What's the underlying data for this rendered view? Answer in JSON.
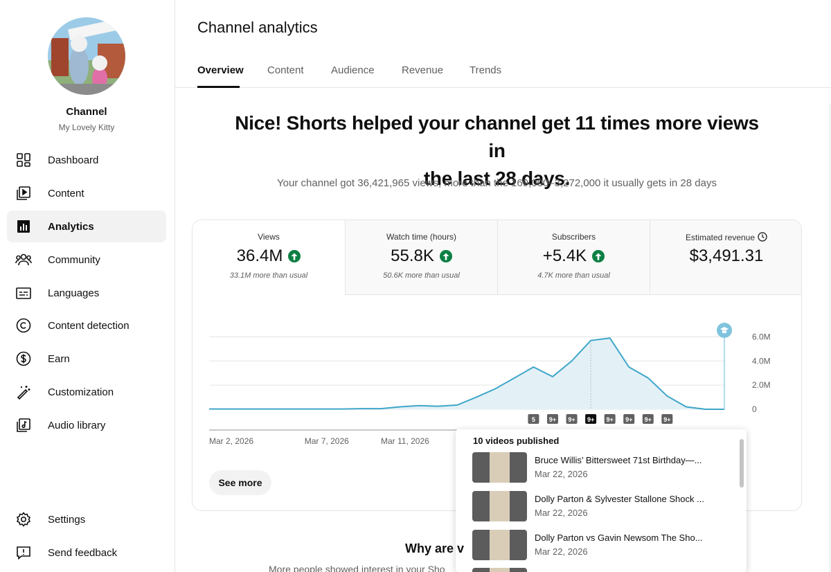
{
  "channel": {
    "title": "Channel",
    "name": "My Lovely Kitty"
  },
  "sidebar": {
    "items": [
      {
        "label": "Dashboard",
        "icon": "dashboard-icon"
      },
      {
        "label": "Content",
        "icon": "content-icon"
      },
      {
        "label": "Analytics",
        "icon": "analytics-icon",
        "active": true
      },
      {
        "label": "Community",
        "icon": "community-icon"
      },
      {
        "label": "Languages",
        "icon": "languages-icon"
      },
      {
        "label": "Content detection",
        "icon": "copyright-icon"
      },
      {
        "label": "Earn",
        "icon": "dollar-icon"
      },
      {
        "label": "Customization",
        "icon": "magic-wand-icon"
      },
      {
        "label": "Audio library",
        "icon": "audio-library-icon"
      }
    ],
    "bottom": [
      {
        "label": "Settings",
        "icon": "gear-icon"
      },
      {
        "label": "Send feedback",
        "icon": "feedback-icon"
      }
    ]
  },
  "header": {
    "title": "Channel analytics",
    "tabs": [
      "Overview",
      "Content",
      "Audience",
      "Revenue",
      "Trends"
    ],
    "active_tab": "Overview"
  },
  "headline": {
    "line1": "Nice! Shorts helped your channel get 11 times more views in",
    "line2": "the last 28 days.",
    "subtitle": "Your channel got 36,421,965 views, more than the 169,000–3,272,000 it usually gets in 28 days"
  },
  "metrics": [
    {
      "label": "Views",
      "value": "36.4M",
      "sub": "33.1M more than usual",
      "trend": "up"
    },
    {
      "label": "Watch time (hours)",
      "value": "55.8K",
      "sub": "50.6K more than usual",
      "trend": "up"
    },
    {
      "label": "Subscribers",
      "value": "+5.4K",
      "sub": "4.7K more than usual",
      "trend": "up"
    },
    {
      "label": "Estimated revenue",
      "value": "$3,491.31",
      "sub": "",
      "trend": "none"
    }
  ],
  "colors": {
    "line": "#3ea6c9",
    "fill": "#e3f1f7",
    "green": "#0b8043",
    "marker": "#7fc4de"
  },
  "chart_data": {
    "type": "area",
    "x": [
      "Mar 2",
      "Mar 3",
      "Mar 4",
      "Mar 5",
      "Mar 6",
      "Mar 7",
      "Mar 8",
      "Mar 9",
      "Mar 10",
      "Mar 11",
      "Mar 12",
      "Mar 13",
      "Mar 14",
      "Mar 15",
      "Mar 16",
      "Mar 17",
      "Mar 18",
      "Mar 19",
      "Mar 20",
      "Mar 21",
      "Mar 22",
      "Mar 23",
      "Mar 24",
      "Mar 25",
      "Mar 26",
      "Mar 27",
      "Mar 28",
      "Mar 29"
    ],
    "series": [
      {
        "values": [
          0.02,
          0.02,
          0.02,
          0.02,
          0.02,
          0.02,
          0.02,
          0.02,
          0.05,
          0.05,
          0.2,
          0.3,
          0.25,
          0.35,
          1.0,
          1.7,
          2.6,
          3.5,
          2.7,
          4.0,
          5.7,
          5.9,
          3.5,
          2.6,
          1.1,
          0.2,
          0.0,
          0.0
        ]
      }
    ],
    "xtick_labels": [
      "Mar 2, 2026",
      "Mar 7, 2026",
      "Mar 11, 2026"
    ],
    "ytick_labels": [
      "6.0M",
      "4.0M",
      "2.0M",
      "0"
    ],
    "ylim": [
      0,
      6.6
    ],
    "marker_labels": [
      "5",
      "9+",
      "9+",
      "9+",
      "9+",
      "9+",
      "9+",
      "9+"
    ],
    "selected_marker": 3,
    "grid": true
  },
  "buttons": {
    "see_more": "See more"
  },
  "popup": {
    "title": "10 videos published",
    "videos": [
      {
        "title": "Bruce Willis’ Bittersweet 71st Birthday—...",
        "date": "Mar 22, 2026"
      },
      {
        "title": "Dolly Parton & Sylvester Stallone Shock ...",
        "date": "Mar 22, 2026"
      },
      {
        "title": "Dolly Parton vs Gavin Newsom The Sho...",
        "date": "Mar 22, 2026"
      }
    ]
  },
  "section": {
    "title": "Why are v",
    "subtitle": "More people showed interest in your Sho"
  }
}
